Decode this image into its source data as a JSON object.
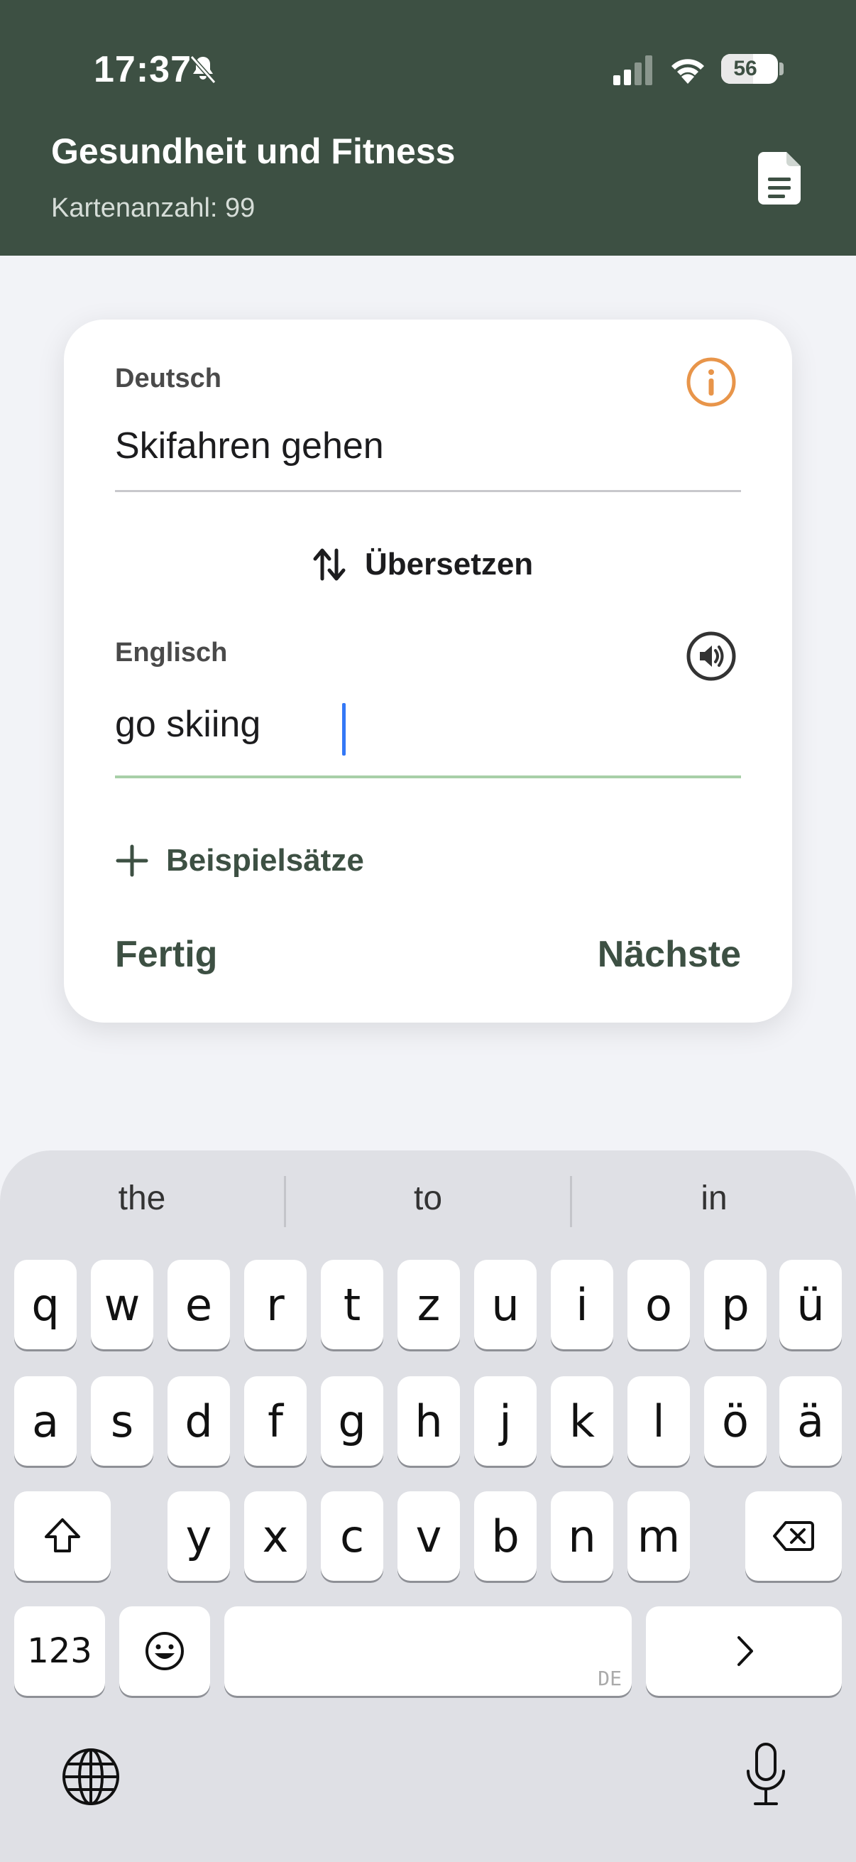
{
  "status_bar": {
    "time": "17:37",
    "battery_percent": "56",
    "battery_level": 0.56
  },
  "header": {
    "title": "Gesundheit und Fitness",
    "subtitle": "Kartenanzahl: 99"
  },
  "card": {
    "source": {
      "label": "Deutsch",
      "value": "Skifahren gehen"
    },
    "translate_label": "Übersetzen",
    "target": {
      "label": "Englisch",
      "value": "go skiing"
    },
    "examples_label": "Beispielsätze",
    "done_label": "Fertig",
    "next_label": "Nächste"
  },
  "keyboard": {
    "suggestions": [
      "the",
      "to",
      "in"
    ],
    "rows": [
      [
        "q",
        "w",
        "e",
        "r",
        "t",
        "z",
        "u",
        "i",
        "o",
        "p",
        "ü"
      ],
      [
        "a",
        "s",
        "d",
        "f",
        "g",
        "h",
        "j",
        "k",
        "l",
        "ö",
        "ä"
      ],
      [
        "y",
        "x",
        "c",
        "v",
        "b",
        "n",
        "m"
      ]
    ],
    "numbers_label": "123",
    "language_mark": "DE"
  },
  "colors": {
    "header_bg": "#3d5043",
    "accent_green": "#3d5043",
    "info_orange": "#e8954a",
    "active_underline": "#a8cfa8",
    "caret": "#3478f6"
  }
}
